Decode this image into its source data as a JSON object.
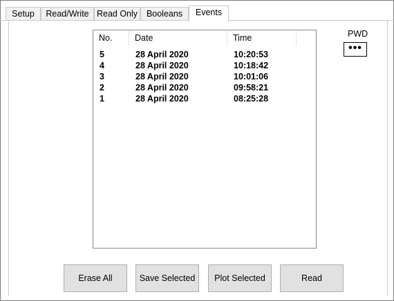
{
  "tabs": [
    {
      "label": "Setup"
    },
    {
      "label": "Read/Write"
    },
    {
      "label": "Read Only"
    },
    {
      "label": "Booleans"
    },
    {
      "label": "Events"
    }
  ],
  "active_tab": "Events",
  "events_list": {
    "columns": [
      "No.",
      "Date",
      "Time"
    ],
    "rows": [
      {
        "no": "5",
        "date": "28 April 2020",
        "time": "10:20:53"
      },
      {
        "no": "4",
        "date": "28 April 2020",
        "time": "10:18:42"
      },
      {
        "no": "3",
        "date": "28 April 2020",
        "time": "10:01:06"
      },
      {
        "no": "2",
        "date": "28 April 2020",
        "time": "09:58:21"
      },
      {
        "no": "1",
        "date": "28 April 2020",
        "time": "08:25:28"
      }
    ]
  },
  "password": {
    "label": "PWD",
    "value": "•••"
  },
  "buttons": {
    "erase_all": "Erase All",
    "save_selected": "Save Selected",
    "plot_selected": "Plot Selected",
    "read": "Read"
  }
}
